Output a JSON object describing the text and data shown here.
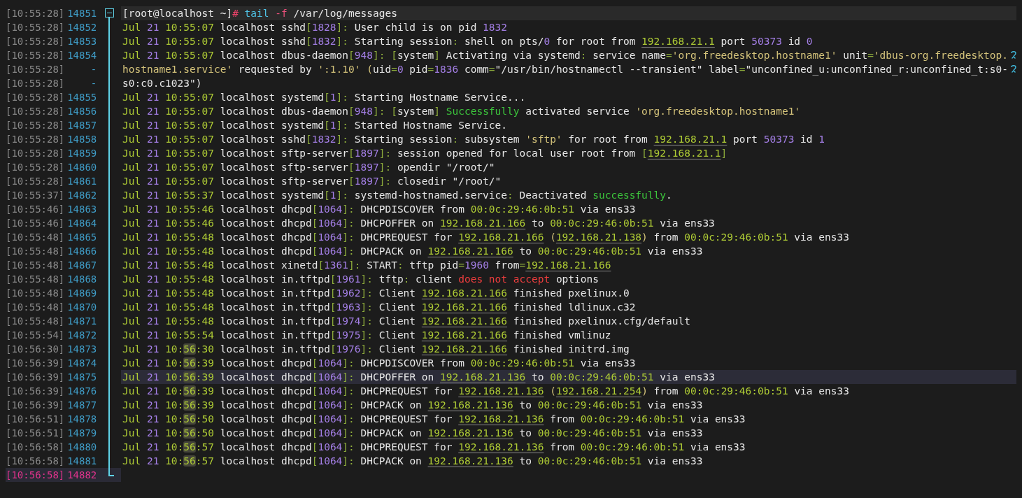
{
  "rows": [
    {
      "clock": "[10:55:28]",
      "number": "14851",
      "fold": {
        "expanded": true
      },
      "kind": "command",
      "highlighted": true,
      "current": false,
      "wrapped": false,
      "segments": [
        {
          "text": "[root@localhost ~]",
          "kind": "plain"
        },
        {
          "text": "#",
          "kind": "hash"
        },
        {
          "text": " tail",
          "kind": "command"
        },
        {
          "text": " -f",
          "kind": "flag"
        },
        {
          "text": " /var/log/messages",
          "kind": "plain"
        }
      ]
    },
    {
      "clock": "[10:55:28]",
      "number": "14852",
      "kind": "log",
      "highlighted": false,
      "current": false,
      "wrapped": false,
      "segments": [
        {
          "text": "Jul ",
          "kind": "month"
        },
        {
          "text": "21 ",
          "kind": "day"
        },
        {
          "text": "10:55:07",
          "kind": "time"
        },
        {
          "text": " localhost sshd",
          "kind": "plain"
        },
        {
          "text": "[",
          "kind": "bracket"
        },
        {
          "text": "1828",
          "kind": "pid"
        },
        {
          "text": "]:",
          "kind": "bracket"
        },
        {
          "text": " User child is on pid ",
          "kind": "plain"
        },
        {
          "text": "1832",
          "kind": "number"
        }
      ]
    },
    {
      "clock": "[10:55:28]",
      "number": "14853",
      "kind": "log",
      "highlighted": false,
      "current": false,
      "wrapped": false,
      "segments": [
        {
          "text": "Jul ",
          "kind": "month"
        },
        {
          "text": "21 ",
          "kind": "day"
        },
        {
          "text": "10:55:07",
          "kind": "time"
        },
        {
          "text": " localhost sshd",
          "kind": "plain"
        },
        {
          "text": "[",
          "kind": "bracket"
        },
        {
          "text": "1832",
          "kind": "pid"
        },
        {
          "text": "]:",
          "kind": "bracket"
        },
        {
          "text": " Starting session",
          "kind": "plain"
        },
        {
          "text": ":",
          "kind": "punct"
        },
        {
          "text": " shell on pts/",
          "kind": "plain"
        },
        {
          "text": "0",
          "kind": "number"
        },
        {
          "text": " for root from ",
          "kind": "plain"
        },
        {
          "text": "192.168.21.1",
          "kind": "ip"
        },
        {
          "text": " port ",
          "kind": "plain"
        },
        {
          "text": "50373",
          "kind": "number"
        },
        {
          "text": " id ",
          "kind": "plain"
        },
        {
          "text": "0",
          "kind": "number"
        }
      ]
    },
    {
      "clock": "[10:55:28]",
      "number": "14854",
      "kind": "log",
      "highlighted": false,
      "current": false,
      "wrapped": true,
      "segments": [
        {
          "text": "Jul ",
          "kind": "month"
        },
        {
          "text": "21 ",
          "kind": "day"
        },
        {
          "text": "10:55:07",
          "kind": "time"
        },
        {
          "text": " localhost dbus-daemon",
          "kind": "plain"
        },
        {
          "text": "[",
          "kind": "bracket"
        },
        {
          "text": "948",
          "kind": "pid"
        },
        {
          "text": "]: [",
          "kind": "bracket"
        },
        {
          "text": "system",
          "kind": "plain"
        },
        {
          "text": "]",
          "kind": "bracket"
        },
        {
          "text": " Activating via systemd",
          "kind": "plain"
        },
        {
          "text": ":",
          "kind": "punct"
        },
        {
          "text": " service name",
          "kind": "plain"
        },
        {
          "text": "=",
          "kind": "punct"
        },
        {
          "text": "'org.freedesktop.hostname1'",
          "kind": "string"
        },
        {
          "text": " unit",
          "kind": "plain"
        },
        {
          "text": "=",
          "kind": "punct"
        },
        {
          "text": "'dbus-org.freedesktop.",
          "kind": "string"
        }
      ]
    },
    {
      "clock": "[10:55:28]",
      "number": "-",
      "kind": "continuation",
      "highlighted": false,
      "current": false,
      "wrapped": true,
      "segments": [
        {
          "text": "hostname1.service'",
          "kind": "string"
        },
        {
          "text": " requested by ",
          "kind": "plain"
        },
        {
          "text": "':1.10'",
          "kind": "string"
        },
        {
          "text": " (",
          "kind": "string"
        },
        {
          "text": "uid",
          "kind": "plain"
        },
        {
          "text": "=",
          "kind": "punct"
        },
        {
          "text": "0",
          "kind": "number"
        },
        {
          "text": " pid",
          "kind": "plain"
        },
        {
          "text": "=",
          "kind": "punct"
        },
        {
          "text": "1836",
          "kind": "number"
        },
        {
          "text": " comm",
          "kind": "plain"
        },
        {
          "text": "=",
          "kind": "punct"
        },
        {
          "text": "\"/usr/bin/hostnamectl --transient\" label",
          "kind": "plain"
        },
        {
          "text": "=",
          "kind": "punct"
        },
        {
          "text": "\"unconfined_u:unconfined_r:unconfined_t:s0-",
          "kind": "plain"
        }
      ]
    },
    {
      "clock": "[10:55:28]",
      "number": "-",
      "kind": "continuation",
      "highlighted": false,
      "current": false,
      "wrapped": false,
      "segments": [
        {
          "text": "s0:c0.c1023\")",
          "kind": "plain"
        }
      ]
    },
    {
      "clock": "[10:55:28]",
      "number": "14855",
      "kind": "log",
      "highlighted": false,
      "current": false,
      "wrapped": false,
      "segments": [
        {
          "text": "Jul ",
          "kind": "month"
        },
        {
          "text": "21 ",
          "kind": "day"
        },
        {
          "text": "10:55:07",
          "kind": "time"
        },
        {
          "text": " localhost systemd",
          "kind": "plain"
        },
        {
          "text": "[",
          "kind": "bracket"
        },
        {
          "text": "1",
          "kind": "pid"
        },
        {
          "text": "]:",
          "kind": "bracket"
        },
        {
          "text": " Starting Hostname Service...",
          "kind": "plain"
        }
      ]
    },
    {
      "clock": "[10:55:28]",
      "number": "14856",
      "kind": "log",
      "highlighted": false,
      "current": false,
      "wrapped": false,
      "segments": [
        {
          "text": "Jul ",
          "kind": "month"
        },
        {
          "text": "21 ",
          "kind": "day"
        },
        {
          "text": "10:55:07",
          "kind": "time"
        },
        {
          "text": " localhost dbus-daemon",
          "kind": "plain"
        },
        {
          "text": "[",
          "kind": "bracket"
        },
        {
          "text": "948",
          "kind": "pid"
        },
        {
          "text": "]: [",
          "kind": "bracket"
        },
        {
          "text": "system",
          "kind": "plain"
        },
        {
          "text": "] ",
          "kind": "bracket"
        },
        {
          "text": "Successfully",
          "kind": "success"
        },
        {
          "text": " activated service ",
          "kind": "plain"
        },
        {
          "text": "'org.freedesktop.hostname1'",
          "kind": "string"
        }
      ]
    },
    {
      "clock": "[10:55:28]",
      "number": "14857",
      "kind": "log",
      "highlighted": false,
      "current": false,
      "wrapped": false,
      "segments": [
        {
          "text": "Jul ",
          "kind": "month"
        },
        {
          "text": "21 ",
          "kind": "day"
        },
        {
          "text": "10:55:07",
          "kind": "time"
        },
        {
          "text": " localhost systemd",
          "kind": "plain"
        },
        {
          "text": "[",
          "kind": "bracket"
        },
        {
          "text": "1",
          "kind": "pid"
        },
        {
          "text": "]:",
          "kind": "bracket"
        },
        {
          "text": " Started Hostname Service.",
          "kind": "plain"
        }
      ]
    },
    {
      "clock": "[10:55:28]",
      "number": "14858",
      "kind": "log",
      "highlighted": false,
      "current": false,
      "wrapped": false,
      "segments": [
        {
          "text": "Jul ",
          "kind": "month"
        },
        {
          "text": "21 ",
          "kind": "day"
        },
        {
          "text": "10:55:07",
          "kind": "time"
        },
        {
          "text": " localhost sshd",
          "kind": "plain"
        },
        {
          "text": "[",
          "kind": "bracket"
        },
        {
          "text": "1832",
          "kind": "pid"
        },
        {
          "text": "]:",
          "kind": "bracket"
        },
        {
          "text": " Starting session",
          "kind": "plain"
        },
        {
          "text": ":",
          "kind": "punct"
        },
        {
          "text": " subsystem ",
          "kind": "plain"
        },
        {
          "text": "'sftp'",
          "kind": "string"
        },
        {
          "text": " for root from ",
          "kind": "plain"
        },
        {
          "text": "192.168.21.1",
          "kind": "ip"
        },
        {
          "text": " port ",
          "kind": "plain"
        },
        {
          "text": "50373",
          "kind": "number"
        },
        {
          "text": " id ",
          "kind": "plain"
        },
        {
          "text": "1",
          "kind": "number"
        }
      ]
    },
    {
      "clock": "[10:55:28]",
      "number": "14859",
      "kind": "log",
      "highlighted": false,
      "current": false,
      "wrapped": false,
      "segments": [
        {
          "text": "Jul ",
          "kind": "month"
        },
        {
          "text": "21 ",
          "kind": "day"
        },
        {
          "text": "10:55:07",
          "kind": "time"
        },
        {
          "text": " localhost sftp-server",
          "kind": "plain"
        },
        {
          "text": "[",
          "kind": "bracket"
        },
        {
          "text": "1897",
          "kind": "pid"
        },
        {
          "text": "]:",
          "kind": "bracket"
        },
        {
          "text": " session opened for local user root from ",
          "kind": "plain"
        },
        {
          "text": "[",
          "kind": "bracket"
        },
        {
          "text": "192.168.21.1",
          "kind": "ip"
        },
        {
          "text": "]",
          "kind": "bracket"
        }
      ]
    },
    {
      "clock": "[10:55:28]",
      "number": "14860",
      "kind": "log",
      "highlighted": false,
      "current": false,
      "wrapped": false,
      "segments": [
        {
          "text": "Jul ",
          "kind": "month"
        },
        {
          "text": "21 ",
          "kind": "day"
        },
        {
          "text": "10:55:07",
          "kind": "time"
        },
        {
          "text": " localhost sftp-server",
          "kind": "plain"
        },
        {
          "text": "[",
          "kind": "bracket"
        },
        {
          "text": "1897",
          "kind": "pid"
        },
        {
          "text": "]:",
          "kind": "bracket"
        },
        {
          "text": " opendir \"/root/\"",
          "kind": "plain"
        }
      ]
    },
    {
      "clock": "[10:55:28]",
      "number": "14861",
      "kind": "log",
      "highlighted": false,
      "current": false,
      "wrapped": false,
      "segments": [
        {
          "text": "Jul ",
          "kind": "month"
        },
        {
          "text": "21 ",
          "kind": "day"
        },
        {
          "text": "10:55:07",
          "kind": "time"
        },
        {
          "text": " localhost sftp-server",
          "kind": "plain"
        },
        {
          "text": "[",
          "kind": "bracket"
        },
        {
          "text": "1897",
          "kind": "pid"
        },
        {
          "text": "]:",
          "kind": "bracket"
        },
        {
          "text": " closedir \"/root/\"",
          "kind": "plain"
        }
      ]
    },
    {
      "clock": "[10:55:37]",
      "number": "14862",
      "kind": "log",
      "highlighted": false,
      "current": false,
      "wrapped": false,
      "segments": [
        {
          "text": "Jul ",
          "kind": "month"
        },
        {
          "text": "21 ",
          "kind": "day"
        },
        {
          "text": "10:55:37",
          "kind": "time"
        },
        {
          "text": " localhost systemd",
          "kind": "plain"
        },
        {
          "text": "[",
          "kind": "bracket"
        },
        {
          "text": "1",
          "kind": "pid"
        },
        {
          "text": "]:",
          "kind": "bracket"
        },
        {
          "text": " systemd-hostnamed.service",
          "kind": "plain"
        },
        {
          "text": ":",
          "kind": "punct"
        },
        {
          "text": " Deactivated ",
          "kind": "plain"
        },
        {
          "text": "successfully",
          "kind": "success"
        },
        {
          "text": ".",
          "kind": "plain"
        }
      ]
    },
    {
      "clock": "[10:55:46]",
      "number": "14863",
      "kind": "log",
      "highlighted": false,
      "current": false,
      "wrapped": false,
      "segments": [
        {
          "text": "Jul ",
          "kind": "month"
        },
        {
          "text": "21 ",
          "kind": "day"
        },
        {
          "text": "10:55:46",
          "kind": "time"
        },
        {
          "text": " localhost dhcpd",
          "kind": "plain"
        },
        {
          "text": "[",
          "kind": "bracket"
        },
        {
          "text": "1064",
          "kind": "pid"
        },
        {
          "text": "]:",
          "kind": "bracket"
        },
        {
          "text": " DHCPDISCOVER from ",
          "kind": "plain"
        },
        {
          "text": "00:0c:29:46:0b:51",
          "kind": "mac"
        },
        {
          "text": " via ens33",
          "kind": "plain"
        }
      ]
    },
    {
      "clock": "[10:55:46]",
      "number": "14864",
      "kind": "log",
      "highlighted": false,
      "current": false,
      "wrapped": false,
      "segments": [
        {
          "text": "Jul ",
          "kind": "month"
        },
        {
          "text": "21 ",
          "kind": "day"
        },
        {
          "text": "10:55:46",
          "kind": "time"
        },
        {
          "text": " localhost dhcpd",
          "kind": "plain"
        },
        {
          "text": "[",
          "kind": "bracket"
        },
        {
          "text": "1064",
          "kind": "pid"
        },
        {
          "text": "]:",
          "kind": "bracket"
        },
        {
          "text": " DHCPOFFER on ",
          "kind": "plain"
        },
        {
          "text": "192.168.21.166",
          "kind": "ip"
        },
        {
          "text": " to ",
          "kind": "plain"
        },
        {
          "text": "00:0c:29:46:0b:51",
          "kind": "mac"
        },
        {
          "text": " via ens33",
          "kind": "plain"
        }
      ]
    },
    {
      "clock": "[10:55:48]",
      "number": "14865",
      "kind": "log",
      "highlighted": false,
      "current": false,
      "wrapped": false,
      "segments": [
        {
          "text": "Jul ",
          "kind": "month"
        },
        {
          "text": "21 ",
          "kind": "day"
        },
        {
          "text": "10:55:48",
          "kind": "time"
        },
        {
          "text": " localhost dhcpd",
          "kind": "plain"
        },
        {
          "text": "[",
          "kind": "bracket"
        },
        {
          "text": "1064",
          "kind": "pid"
        },
        {
          "text": "]:",
          "kind": "bracket"
        },
        {
          "text": " DHCPREQUEST for ",
          "kind": "plain"
        },
        {
          "text": "192.168.21.166",
          "kind": "ip"
        },
        {
          "text": " (",
          "kind": "string"
        },
        {
          "text": "192.168.21.138",
          "kind": "ip"
        },
        {
          "text": ")",
          "kind": "string"
        },
        {
          "text": " from ",
          "kind": "plain"
        },
        {
          "text": "00:0c:29:46:0b:51",
          "kind": "mac"
        },
        {
          "text": " via ens33",
          "kind": "plain"
        }
      ]
    },
    {
      "clock": "[10:55:48]",
      "number": "14866",
      "kind": "log",
      "highlighted": false,
      "current": false,
      "wrapped": false,
      "segments": [
        {
          "text": "Jul ",
          "kind": "month"
        },
        {
          "text": "21 ",
          "kind": "day"
        },
        {
          "text": "10:55:48",
          "kind": "time"
        },
        {
          "text": " localhost dhcpd",
          "kind": "plain"
        },
        {
          "text": "[",
          "kind": "bracket"
        },
        {
          "text": "1064",
          "kind": "pid"
        },
        {
          "text": "]:",
          "kind": "bracket"
        },
        {
          "text": " DHCPACK on ",
          "kind": "plain"
        },
        {
          "text": "192.168.21.166",
          "kind": "ip"
        },
        {
          "text": " to ",
          "kind": "plain"
        },
        {
          "text": "00:0c:29:46:0b:51",
          "kind": "mac"
        },
        {
          "text": " via ens33",
          "kind": "plain"
        }
      ]
    },
    {
      "clock": "[10:55:48]",
      "number": "14867",
      "kind": "log",
      "highlighted": false,
      "current": false,
      "wrapped": false,
      "segments": [
        {
          "text": "Jul ",
          "kind": "month"
        },
        {
          "text": "21 ",
          "kind": "day"
        },
        {
          "text": "10:55:48",
          "kind": "time"
        },
        {
          "text": " localhost xinetd",
          "kind": "plain"
        },
        {
          "text": "[",
          "kind": "bracket"
        },
        {
          "text": "1361",
          "kind": "pid"
        },
        {
          "text": "]:",
          "kind": "bracket"
        },
        {
          "text": " START",
          "kind": "plain"
        },
        {
          "text": ":",
          "kind": "punct"
        },
        {
          "text": " tftp pid",
          "kind": "plain"
        },
        {
          "text": "=",
          "kind": "punct"
        },
        {
          "text": "1960",
          "kind": "number"
        },
        {
          "text": " from",
          "kind": "plain"
        },
        {
          "text": "=",
          "kind": "punct"
        },
        {
          "text": "192.168.21.166",
          "kind": "ip"
        }
      ]
    },
    {
      "clock": "[10:55:48]",
      "number": "14868",
      "kind": "log",
      "highlighted": false,
      "current": false,
      "wrapped": false,
      "segments": [
        {
          "text": "Jul ",
          "kind": "month"
        },
        {
          "text": "21 ",
          "kind": "day"
        },
        {
          "text": "10:55:48",
          "kind": "time"
        },
        {
          "text": " localhost in.tftpd",
          "kind": "plain"
        },
        {
          "text": "[",
          "kind": "bracket"
        },
        {
          "text": "1961",
          "kind": "pid"
        },
        {
          "text": "]:",
          "kind": "bracket"
        },
        {
          "text": " tftp",
          "kind": "plain"
        },
        {
          "text": ":",
          "kind": "punct"
        },
        {
          "text": " client ",
          "kind": "plain"
        },
        {
          "text": "does not accept",
          "kind": "error"
        },
        {
          "text": " options",
          "kind": "plain"
        }
      ]
    },
    {
      "clock": "[10:55:48]",
      "number": "14869",
      "kind": "log",
      "highlighted": false,
      "current": false,
      "wrapped": false,
      "segments": [
        {
          "text": "Jul ",
          "kind": "month"
        },
        {
          "text": "21 ",
          "kind": "day"
        },
        {
          "text": "10:55:48",
          "kind": "time"
        },
        {
          "text": " localhost in.tftpd",
          "kind": "plain"
        },
        {
          "text": "[",
          "kind": "bracket"
        },
        {
          "text": "1962",
          "kind": "pid"
        },
        {
          "text": "]:",
          "kind": "bracket"
        },
        {
          "text": " Client ",
          "kind": "plain"
        },
        {
          "text": "192.168.21.166",
          "kind": "ip"
        },
        {
          "text": " finished pxelinux.0",
          "kind": "plain"
        }
      ]
    },
    {
      "clock": "[10:55:48]",
      "number": "14870",
      "kind": "log",
      "highlighted": false,
      "current": false,
      "wrapped": false,
      "segments": [
        {
          "text": "Jul ",
          "kind": "month"
        },
        {
          "text": "21 ",
          "kind": "day"
        },
        {
          "text": "10:55:48",
          "kind": "time"
        },
        {
          "text": " localhost in.tftpd",
          "kind": "plain"
        },
        {
          "text": "[",
          "kind": "bracket"
        },
        {
          "text": "1963",
          "kind": "pid"
        },
        {
          "text": "]:",
          "kind": "bracket"
        },
        {
          "text": " Client ",
          "kind": "plain"
        },
        {
          "text": "192.168.21.166",
          "kind": "ip"
        },
        {
          "text": " finished ldlinux.c32",
          "kind": "plain"
        }
      ]
    },
    {
      "clock": "[10:55:48]",
      "number": "14871",
      "kind": "log",
      "highlighted": false,
      "current": false,
      "wrapped": false,
      "segments": [
        {
          "text": "Jul ",
          "kind": "month"
        },
        {
          "text": "21 ",
          "kind": "day"
        },
        {
          "text": "10:55:48",
          "kind": "time"
        },
        {
          "text": " localhost in.tftpd",
          "kind": "plain"
        },
        {
          "text": "[",
          "kind": "bracket"
        },
        {
          "text": "1974",
          "kind": "pid"
        },
        {
          "text": "]:",
          "kind": "bracket"
        },
        {
          "text": " Client ",
          "kind": "plain"
        },
        {
          "text": "192.168.21.166",
          "kind": "ip"
        },
        {
          "text": " finished pxelinux.cfg/default",
          "kind": "plain"
        }
      ]
    },
    {
      "clock": "[10:55:54]",
      "number": "14872",
      "kind": "log",
      "highlighted": false,
      "current": false,
      "wrapped": false,
      "segments": [
        {
          "text": "Jul ",
          "kind": "month"
        },
        {
          "text": "21 ",
          "kind": "day"
        },
        {
          "text": "10:55:54",
          "kind": "time"
        },
        {
          "text": " localhost in.tftpd",
          "kind": "plain"
        },
        {
          "text": "[",
          "kind": "bracket"
        },
        {
          "text": "1975",
          "kind": "pid"
        },
        {
          "text": "]:",
          "kind": "bracket"
        },
        {
          "text": " Client ",
          "kind": "plain"
        },
        {
          "text": "192.168.21.166",
          "kind": "ip"
        },
        {
          "text": " finished vmlinuz",
          "kind": "plain"
        }
      ]
    },
    {
      "clock": "[10:56:30]",
      "number": "14873",
      "kind": "log",
      "highlighted": false,
      "current": false,
      "wrapped": false,
      "segments": [
        {
          "text": "Jul ",
          "kind": "month"
        },
        {
          "text": "21 ",
          "kind": "day"
        },
        {
          "text": "10:",
          "kind": "time"
        },
        {
          "text": "56",
          "kind": "time-match"
        },
        {
          "text": ":30",
          "kind": "time"
        },
        {
          "text": " localhost in.tftpd",
          "kind": "plain"
        },
        {
          "text": "[",
          "kind": "bracket"
        },
        {
          "text": "1976",
          "kind": "pid"
        },
        {
          "text": "]:",
          "kind": "bracket"
        },
        {
          "text": " Client ",
          "kind": "plain"
        },
        {
          "text": "192.168.21.166",
          "kind": "ip"
        },
        {
          "text": " finished initrd.img",
          "kind": "plain"
        }
      ]
    },
    {
      "clock": "[10:56:39]",
      "number": "14874",
      "kind": "log",
      "highlighted": false,
      "current": false,
      "wrapped": false,
      "segments": [
        {
          "text": "Jul ",
          "kind": "month"
        },
        {
          "text": "21 ",
          "kind": "day"
        },
        {
          "text": "10:",
          "kind": "time"
        },
        {
          "text": "56",
          "kind": "time-match"
        },
        {
          "text": ":39",
          "kind": "time"
        },
        {
          "text": " localhost dhcpd",
          "kind": "plain"
        },
        {
          "text": "[",
          "kind": "bracket"
        },
        {
          "text": "1064",
          "kind": "pid"
        },
        {
          "text": "]:",
          "kind": "bracket"
        },
        {
          "text": " DHCPDISCOVER from ",
          "kind": "plain"
        },
        {
          "text": "00:0c:29:46:0b:51",
          "kind": "mac"
        },
        {
          "text": " via ens33",
          "kind": "plain"
        }
      ]
    },
    {
      "clock": "[10:56:39]",
      "number": "14875",
      "kind": "log",
      "highlighted": true,
      "current": false,
      "wrapped": false,
      "segments": [
        {
          "text": "Jul ",
          "kind": "month"
        },
        {
          "text": "21 ",
          "kind": "day"
        },
        {
          "text": "10:",
          "kind": "time"
        },
        {
          "text": "56",
          "kind": "time-match"
        },
        {
          "text": ":39",
          "kind": "time"
        },
        {
          "text": " localhost dhcpd",
          "kind": "plain"
        },
        {
          "text": "[",
          "kind": "bracket"
        },
        {
          "text": "1064",
          "kind": "pid"
        },
        {
          "text": "]:",
          "kind": "bracket"
        },
        {
          "text": " DHCPOFFER on ",
          "kind": "plain"
        },
        {
          "text": "192.168.21.136",
          "kind": "ip"
        },
        {
          "text": " to ",
          "kind": "plain"
        },
        {
          "text": "00:0c:29:46:0b:51",
          "kind": "mac"
        },
        {
          "text": " via ens33",
          "kind": "plain"
        }
      ]
    },
    {
      "clock": "[10:56:39]",
      "number": "14876",
      "kind": "log",
      "highlighted": false,
      "current": false,
      "wrapped": false,
      "segments": [
        {
          "text": "Jul ",
          "kind": "month"
        },
        {
          "text": "21 ",
          "kind": "day"
        },
        {
          "text": "10:",
          "kind": "time"
        },
        {
          "text": "56",
          "kind": "time-match"
        },
        {
          "text": ":39",
          "kind": "time"
        },
        {
          "text": " localhost dhcpd",
          "kind": "plain"
        },
        {
          "text": "[",
          "kind": "bracket"
        },
        {
          "text": "1064",
          "kind": "pid"
        },
        {
          "text": "]:",
          "kind": "bracket"
        },
        {
          "text": " DHCPREQUEST for ",
          "kind": "plain"
        },
        {
          "text": "192.168.21.136",
          "kind": "ip"
        },
        {
          "text": " (",
          "kind": "string"
        },
        {
          "text": "192.168.21.254",
          "kind": "ip"
        },
        {
          "text": ")",
          "kind": "string"
        },
        {
          "text": " from ",
          "kind": "plain"
        },
        {
          "text": "00:0c:29:46:0b:51",
          "kind": "mac"
        },
        {
          "text": " via ens33",
          "kind": "plain"
        }
      ]
    },
    {
      "clock": "[10:56:39]",
      "number": "14877",
      "kind": "log",
      "highlighted": false,
      "current": false,
      "wrapped": false,
      "segments": [
        {
          "text": "Jul ",
          "kind": "month"
        },
        {
          "text": "21 ",
          "kind": "day"
        },
        {
          "text": "10:",
          "kind": "time"
        },
        {
          "text": "56",
          "kind": "time-match"
        },
        {
          "text": ":39",
          "kind": "time"
        },
        {
          "text": " localhost dhcpd",
          "kind": "plain"
        },
        {
          "text": "[",
          "kind": "bracket"
        },
        {
          "text": "1064",
          "kind": "pid"
        },
        {
          "text": "]:",
          "kind": "bracket"
        },
        {
          "text": " DHCPACK on ",
          "kind": "plain"
        },
        {
          "text": "192.168.21.136",
          "kind": "ip"
        },
        {
          "text": " to ",
          "kind": "plain"
        },
        {
          "text": "00:0c:29:46:0b:51",
          "kind": "mac"
        },
        {
          "text": " via ens33",
          "kind": "plain"
        }
      ]
    },
    {
      "clock": "[10:56:51]",
      "number": "14878",
      "kind": "log",
      "highlighted": false,
      "current": false,
      "wrapped": false,
      "segments": [
        {
          "text": "Jul ",
          "kind": "month"
        },
        {
          "text": "21 ",
          "kind": "day"
        },
        {
          "text": "10:",
          "kind": "time"
        },
        {
          "text": "56",
          "kind": "time-match"
        },
        {
          "text": ":50",
          "kind": "time"
        },
        {
          "text": " localhost dhcpd",
          "kind": "plain"
        },
        {
          "text": "[",
          "kind": "bracket"
        },
        {
          "text": "1064",
          "kind": "pid"
        },
        {
          "text": "]:",
          "kind": "bracket"
        },
        {
          "text": " DHCPREQUEST for ",
          "kind": "plain"
        },
        {
          "text": "192.168.21.136",
          "kind": "ip"
        },
        {
          "text": " from ",
          "kind": "plain"
        },
        {
          "text": "00:0c:29:46:0b:51",
          "kind": "mac"
        },
        {
          "text": " via ens33",
          "kind": "plain"
        }
      ]
    },
    {
      "clock": "[10:56:51]",
      "number": "14879",
      "kind": "log",
      "highlighted": false,
      "current": false,
      "wrapped": false,
      "segments": [
        {
          "text": "Jul ",
          "kind": "month"
        },
        {
          "text": "21 ",
          "kind": "day"
        },
        {
          "text": "10:",
          "kind": "time"
        },
        {
          "text": "56",
          "kind": "time-match"
        },
        {
          "text": ":50",
          "kind": "time"
        },
        {
          "text": " localhost dhcpd",
          "kind": "plain"
        },
        {
          "text": "[",
          "kind": "bracket"
        },
        {
          "text": "1064",
          "kind": "pid"
        },
        {
          "text": "]:",
          "kind": "bracket"
        },
        {
          "text": " DHCPACK on ",
          "kind": "plain"
        },
        {
          "text": "192.168.21.136",
          "kind": "ip"
        },
        {
          "text": " to ",
          "kind": "plain"
        },
        {
          "text": "00:0c:29:46:0b:51",
          "kind": "mac"
        },
        {
          "text": " via ens33",
          "kind": "plain"
        }
      ]
    },
    {
      "clock": "[10:56:58]",
      "number": "14880",
      "kind": "log",
      "highlighted": false,
      "current": false,
      "wrapped": false,
      "segments": [
        {
          "text": "Jul ",
          "kind": "month"
        },
        {
          "text": "21 ",
          "kind": "day"
        },
        {
          "text": "10:",
          "kind": "time"
        },
        {
          "text": "56",
          "kind": "time-match"
        },
        {
          "text": ":57",
          "kind": "time"
        },
        {
          "text": " localhost dhcpd",
          "kind": "plain"
        },
        {
          "text": "[",
          "kind": "bracket"
        },
        {
          "text": "1064",
          "kind": "pid"
        },
        {
          "text": "]:",
          "kind": "bracket"
        },
        {
          "text": " DHCPREQUEST for ",
          "kind": "plain"
        },
        {
          "text": "192.168.21.136",
          "kind": "ip"
        },
        {
          "text": " from ",
          "kind": "plain"
        },
        {
          "text": "00:0c:29:46:0b:51",
          "kind": "mac"
        },
        {
          "text": " via ens33",
          "kind": "plain"
        }
      ]
    },
    {
      "clock": "[10:56:58]",
      "number": "14881",
      "kind": "log",
      "highlighted": false,
      "current": false,
      "wrapped": false,
      "segments": [
        {
          "text": "Jul ",
          "kind": "month"
        },
        {
          "text": "21 ",
          "kind": "day"
        },
        {
          "text": "10:",
          "kind": "time"
        },
        {
          "text": "56",
          "kind": "time-match"
        },
        {
          "text": ":57",
          "kind": "time"
        },
        {
          "text": " localhost dhcpd",
          "kind": "plain"
        },
        {
          "text": "[",
          "kind": "bracket"
        },
        {
          "text": "1064",
          "kind": "pid"
        },
        {
          "text": "]:",
          "kind": "bracket"
        },
        {
          "text": " DHCPACK on ",
          "kind": "plain"
        },
        {
          "text": "192.168.21.136",
          "kind": "ip"
        },
        {
          "text": " to ",
          "kind": "plain"
        },
        {
          "text": "00:0c:29:46:0b:51",
          "kind": "mac"
        },
        {
          "text": " via ens33",
          "kind": "plain"
        }
      ]
    },
    {
      "clock": "[10:56:58]",
      "number": "14882",
      "kind": "empty",
      "current": true
    }
  ]
}
